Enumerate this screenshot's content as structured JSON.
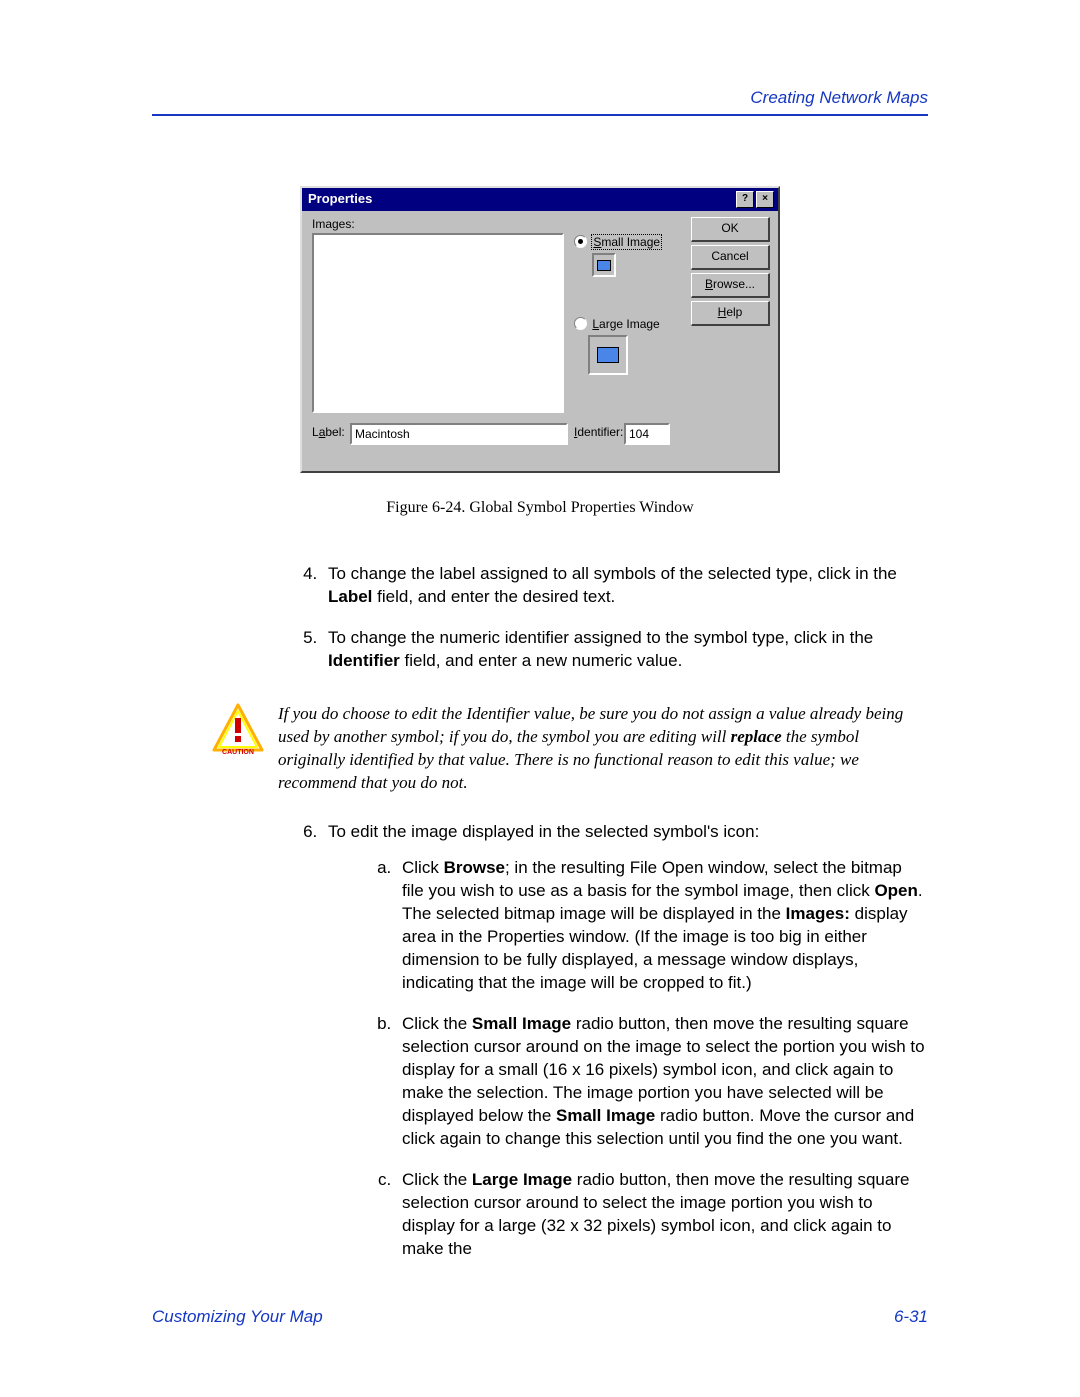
{
  "header": {
    "section_title": "Creating Network Maps"
  },
  "dialog": {
    "title": "Properties",
    "help_glyph": "?",
    "close_glyph": "×",
    "images_label": "Images:",
    "small_image_prefix": "S",
    "small_image_rest": "mall Image",
    "large_image_prefix": "L",
    "large_image_rest": "arge Image",
    "label_prefix": "L",
    "label_underline": "a",
    "label_rest": "bel:",
    "label_value": "Macintosh",
    "identifier_prefix": "I",
    "identifier_rest": "dentifier:",
    "identifier_value": "104",
    "btn_ok": "OK",
    "btn_cancel": "Cancel",
    "btn_browse_prefix": "B",
    "btn_browse_rest": "rowse...",
    "btn_help_prefix": "H",
    "btn_help_rest": "elp"
  },
  "figure_caption": "Figure 6-24. Global Symbol Properties Window",
  "steps": {
    "s4_a": "To change the label assigned to all symbols of the selected type, click in the ",
    "s4_b": "Label",
    "s4_c": " field, and enter the desired text.",
    "s5_a": "To change the numeric identifier assigned to the symbol type, click in the ",
    "s5_b": "Identifier",
    "s5_c": " field, and enter a new numeric value.",
    "s6": "To edit the image displayed in the selected symbol's icon:",
    "s6a_1": "Click ",
    "s6a_2": "Browse",
    "s6a_3": "; in the resulting File Open window, select the bitmap file you wish to use as a basis for the symbol image, then click ",
    "s6a_4": "Open",
    "s6a_5": ". The selected bitmap image will be displayed in the ",
    "s6a_6": "Images:",
    "s6a_7": " display area in the Properties window. (If the image is too big in either dimension to be fully displayed, a message window displays, indicating that the image will be cropped to fit.)",
    "s6b_1": "Click the ",
    "s6b_2": "Small Image",
    "s6b_3": " radio button, then move the resulting square selection cursor around on the image to select the portion you wish to display for a small (16 x 16 pixels) symbol icon, and click again to make the selection. The image portion you have selected will be displayed below the ",
    "s6b_4": "Small Image",
    "s6b_5": " radio button. Move the cursor and click again to change this selection until you find the one you want.",
    "s6c_1": "Click the ",
    "s6c_2": "Large Image",
    "s6c_3": " radio button, then move the resulting square selection cursor around to select the image portion you wish to display for a large (32 x 32 pixels) symbol icon, and click again to make the"
  },
  "caution": {
    "label": "CAUTION",
    "t1": "If you do choose to edit the Identifier value, be sure you do not assign a value already being used by another symbol; if you do, the symbol you are editing will ",
    "t2": "replace",
    "t3": " the symbol originally identified by that value. There is no functional reason to edit this value; we recommend that you do not."
  },
  "footer": {
    "left": "Customizing Your Map",
    "right": "6-31"
  }
}
